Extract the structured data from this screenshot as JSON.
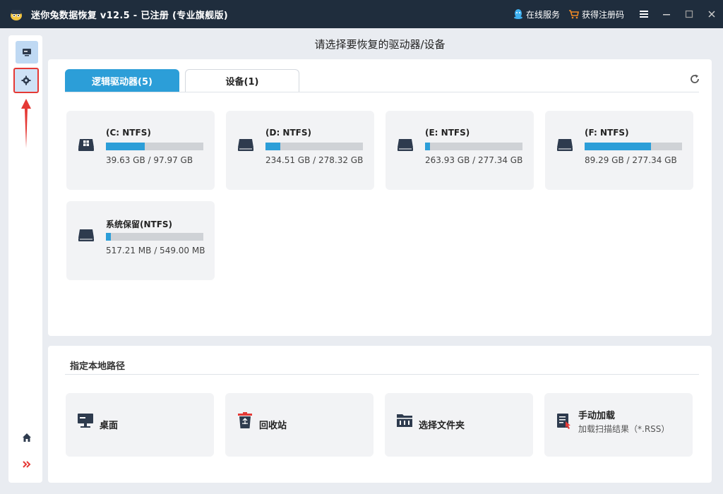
{
  "titlebar": {
    "title": "迷你兔数据恢复 v12.5 - 已注册 (专业旗舰版)",
    "online_service": "在线服务",
    "get_code": "获得注册码"
  },
  "page": {
    "title": "请选择要恢复的驱动器/设备"
  },
  "tabs": [
    {
      "label": "逻辑驱动器(5)",
      "active": true
    },
    {
      "label": "设备(1)",
      "active": false
    }
  ],
  "drives": [
    {
      "name": "(C: NTFS)",
      "size": "39.63 GB / 97.97 GB",
      "used_fraction": 0.4,
      "icon": "windows-drive-icon"
    },
    {
      "name": "(D: NTFS)",
      "size": "234.51 GB / 278.32 GB",
      "used_fraction": 0.15,
      "icon": "hard-drive-icon"
    },
    {
      "name": "(E: NTFS)",
      "size": "263.93 GB / 277.34 GB",
      "used_fraction": 0.05,
      "icon": "hard-drive-icon"
    },
    {
      "name": "(F: NTFS)",
      "size": "89.29 GB / 277.34 GB",
      "used_fraction": 0.68,
      "icon": "hard-drive-icon"
    },
    {
      "name": "系统保留(NTFS)",
      "size": "517.21 MB / 549.00 MB",
      "used_fraction": 0.05,
      "icon": "hard-drive-icon"
    }
  ],
  "local_path": {
    "title": "指定本地路径",
    "items": [
      {
        "label": "桌面",
        "icon": "desktop-icon"
      },
      {
        "label": "回收站",
        "icon": "recycle-bin-icon"
      },
      {
        "label": "选择文件夹",
        "icon": "folder-icon"
      },
      {
        "label": "手动加载",
        "sub": "加载扫描结果（*.RSS）",
        "icon": "manual-load-icon"
      }
    ]
  },
  "colors": {
    "accent": "#2c9ed8",
    "titlebar": "#1f2d3d",
    "highlight_box": "#e53935"
  }
}
